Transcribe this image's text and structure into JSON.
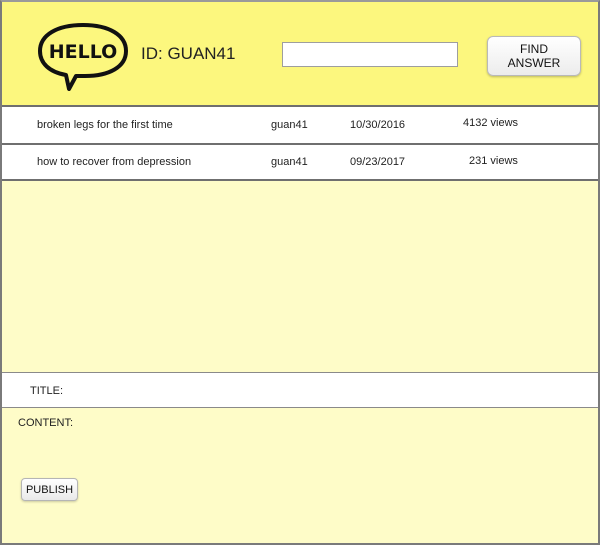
{
  "header": {
    "logo_text": "HELLO",
    "user_id": "ID: GUAN41",
    "search_value": "",
    "search_placeholder": "",
    "find_button_label": "FIND ANSWER"
  },
  "posts": [
    {
      "title": "broken legs for the first time",
      "author": "guan41",
      "date": "10/30/2016",
      "views": "4132 views"
    },
    {
      "title": "how to recover from depression",
      "author": "guan41",
      "date": "09/23/2017",
      "views": "231 views"
    }
  ],
  "compose": {
    "title_label": "TITLE:",
    "content_label": "CONTENT:",
    "publish_label": "PUBLISH"
  },
  "colors": {
    "header_bg": "#fcf77e",
    "panel_bg": "#fefcc8",
    "border": "#6f6f6f"
  }
}
